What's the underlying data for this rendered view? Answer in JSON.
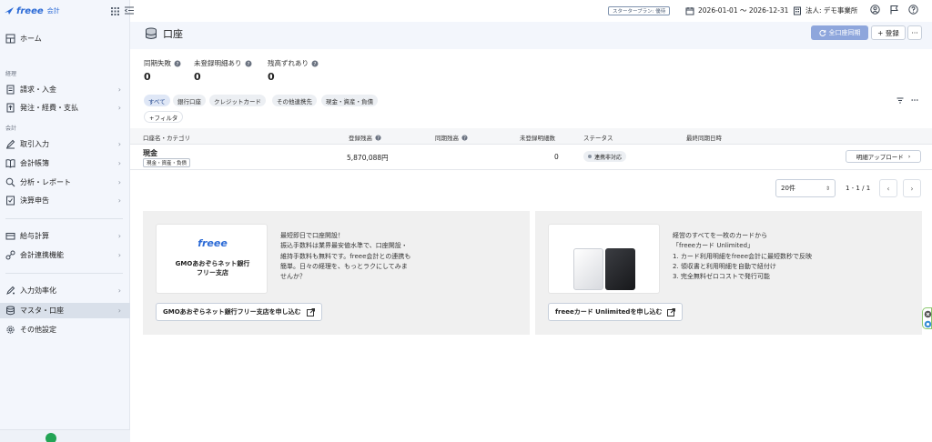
{
  "app": {
    "brand": "freee",
    "name": "会計"
  },
  "topbar": {
    "plan_badge": "スタータープラン: 優待",
    "period": "2026-01-01 〜 2026-12-31",
    "company": "法人: デモ事業所"
  },
  "sidebar": {
    "home": "ホーム",
    "sections": {
      "keiri": "経理",
      "kaikei": "会計"
    },
    "items": [
      {
        "label": "請求・入金"
      },
      {
        "label": "発注・経費・支払"
      },
      {
        "label": "取引入力"
      },
      {
        "label": "会計帳簿"
      },
      {
        "label": "分析・レポート"
      },
      {
        "label": "決算申告"
      },
      {
        "label": "給与計算"
      },
      {
        "label": "会計連携機能"
      },
      {
        "label": "入力効率化"
      },
      {
        "label": "マスタ・口座"
      },
      {
        "label": "その他設定"
      }
    ]
  },
  "page": {
    "title": "口座",
    "sync_all_label": "全口座同期",
    "register_label": "+ 登録",
    "more_label": "···"
  },
  "stats": [
    {
      "label": "同期失敗",
      "value": "0"
    },
    {
      "label": "未登録明細あり",
      "value": "0"
    },
    {
      "label": "残高ずれあり",
      "value": "0"
    }
  ],
  "filters": {
    "chips": [
      "すべて",
      "銀行口座",
      "クレジットカード",
      "その他連携先",
      "現金・資産・負債"
    ],
    "add_filter": "+フィルタ"
  },
  "table": {
    "headers": {
      "name": "口座名・カテゴリ",
      "balance": "登録残高",
      "synced_balance": "同期残高",
      "unregistered": "未登録明細数",
      "status": "ステータス",
      "last_sync": "最終同期日時"
    },
    "rows": [
      {
        "name": "現金",
        "category": "現金・資産・負債",
        "balance": "5,870,088円",
        "unregistered": "0",
        "status": "連携非対応",
        "action": "明細アップロード"
      }
    ]
  },
  "pagination": {
    "per_page": "20件",
    "info": "1 - 1 / 1"
  },
  "promos": [
    {
      "logo_text": "freee",
      "bank_name_1": "GMOあおぞらネット銀行",
      "bank_name_2": "フリー支店",
      "lines": [
        "最短即日で口座開設！",
        "振込手数料は業界最安値水準で、口座開設・",
        "維持手数料も無料です。freee会計との連携も",
        "簡単。日々の経理を、もっとラクにしてみま",
        "せんか？"
      ],
      "button": "GMOあおぞらネット銀行フリー支店を申し込む"
    },
    {
      "lines": [
        "経営のすべてを一枚のカードから",
        "「freeeカード Unlimited」",
        "1. カード利用明細をfreee会計に最短数秒で反映",
        "2. 領収書と利用明細を自動で紐付け",
        "3. 完全無料ゼロコストで発行可能"
      ],
      "button": "freeeカード Unlimitedを申し込む"
    }
  ],
  "colors": {
    "accent": "#2b6ad6",
    "sync_button": "#8ea6dc",
    "sidebar_bg": "#f3f6fc",
    "promo_bg": "#f0f0f0"
  }
}
